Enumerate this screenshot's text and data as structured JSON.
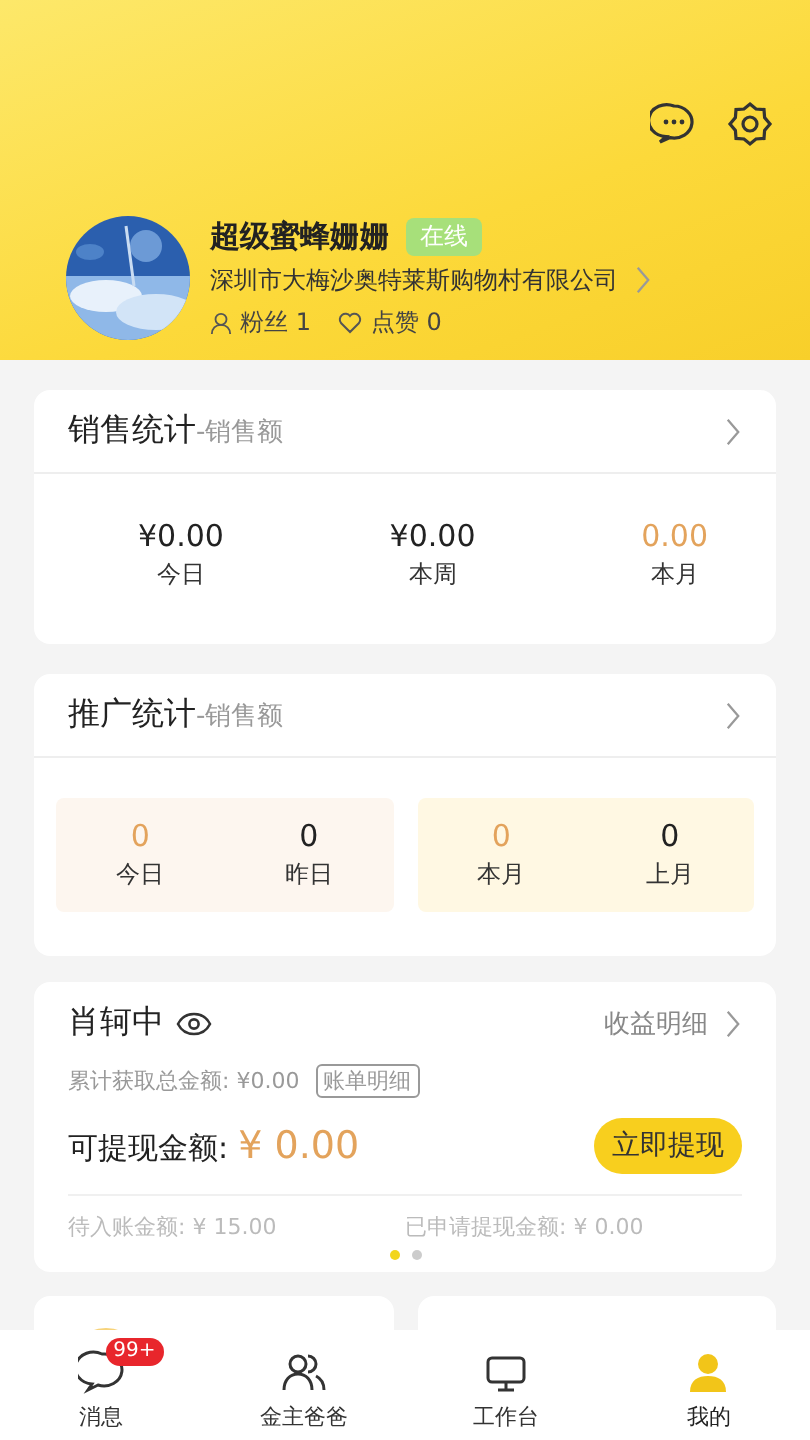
{
  "profile": {
    "name": "超级蜜蜂姗姗",
    "status": "在线",
    "company": "深圳市大梅沙奥特莱斯购物村有限公司",
    "fans_label": "粉丝",
    "fans": "1",
    "likes_label": "点赞",
    "likes": "0"
  },
  "sales": {
    "title": "销售统计",
    "subtitle": "-销售额",
    "stats": [
      {
        "value": "¥0.00",
        "label": "今日",
        "highlight": false
      },
      {
        "value": "¥0.00",
        "label": "本周",
        "highlight": false
      },
      {
        "value": "0.00",
        "label": "本月",
        "highlight": true
      }
    ]
  },
  "promotion": {
    "title": "推广统计",
    "subtitle": "-销售额",
    "groups": [
      {
        "color": "#fdf6ef",
        "stats": [
          {
            "value": "0",
            "label": "今日",
            "highlight": true
          },
          {
            "value": "0",
            "label": "昨日",
            "highlight": false
          }
        ]
      },
      {
        "color": "#fff8e3",
        "stats": [
          {
            "value": "0",
            "label": "本月",
            "highlight": true
          },
          {
            "value": "0",
            "label": "上月",
            "highlight": false
          }
        ]
      }
    ]
  },
  "wallet": {
    "name": "肖轲中",
    "detail_link": "收益明细",
    "total_label": "累计获取总金额:",
    "total": "¥0.00",
    "bill_button": "账单明细",
    "withdrawable_label": "可提现金额:",
    "withdrawable": "¥ 0.00",
    "withdraw_button": "立即提现",
    "pending_label": "待入账金额:",
    "pending": "¥ 15.00",
    "applied_label": "已申请提现金额:",
    "applied": "¥ 0.00",
    "pages": [
      {
        "selected": true
      },
      {
        "selected": false
      }
    ]
  },
  "tabs": [
    {
      "label": "消息",
      "badge": "99+",
      "selected": false
    },
    {
      "label": "金主爸爸",
      "selected": false
    },
    {
      "label": "工作台",
      "selected": false
    },
    {
      "label": "我的",
      "selected": true
    }
  ]
}
